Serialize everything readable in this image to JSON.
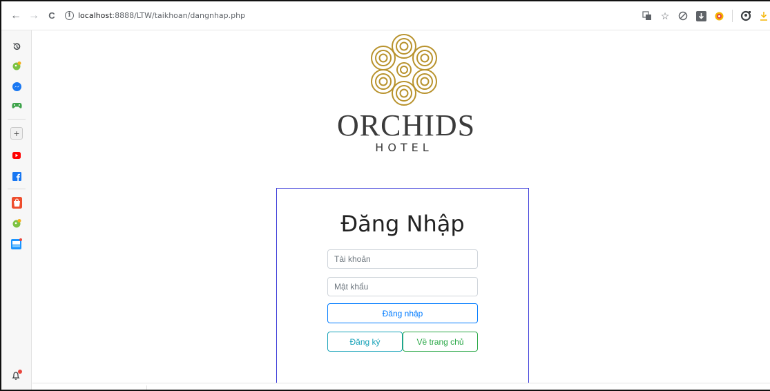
{
  "browser": {
    "back_icon": "←",
    "forward_icon": "→",
    "reload_icon": "C",
    "info_icon": "i",
    "url_host": "localhost",
    "url_rest": ":8888/LTW/taikhoan/dangnhap.php",
    "toolbar_icons": [
      "translate-icon",
      "star-icon",
      "shield-icon",
      "download-box-icon",
      "extension-icon",
      "profile-icon",
      "download-icon"
    ]
  },
  "sidebar": {
    "items": [
      "history-icon",
      "extension-leaf-icon",
      "messenger-icon",
      "gamepad-icon",
      "add-icon",
      "youtube-icon",
      "facebook-icon",
      "shopee-icon",
      "extension-leaf-icon",
      "tiki-icon",
      "notification-bell-icon"
    ],
    "colors": {
      "messenger": "#1877f2",
      "youtube": "#ff0000",
      "facebook": "#1877f2",
      "shopee": "#ee4d2d",
      "tiki": "#1a94ff",
      "green": "#55b949"
    }
  },
  "brand": {
    "name": "ORCHIDS",
    "sub": "HOTEL",
    "logo_color": "#b8922c"
  },
  "login": {
    "title": "Đăng Nhập",
    "username_placeholder": "Tài khoản",
    "password_placeholder": "Mật khẩu",
    "login_button": "Đăng nhập",
    "register_button": "Đăng ký",
    "home_button": "Về trang chủ"
  }
}
